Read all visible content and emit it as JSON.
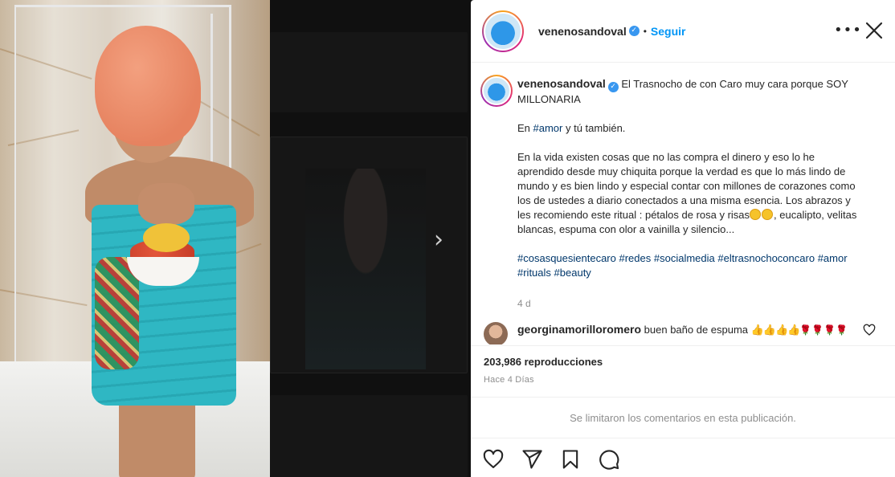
{
  "post": {
    "username": "venenosandoval",
    "verified_mark": "✓",
    "separator": "•",
    "follow_label": "Seguir",
    "more_label": "•••",
    "caption": {
      "line1": "El Trasnocho de con Caro muy cara porque SOY MILLONARIA",
      "para2_prefix": "En ",
      "para2_tag": "#amor",
      "para2_suffix": " y tú también.",
      "para3_main": "En la vida existen cosas que no las compra el dinero y eso lo he aprendido desde muy chiquita porque la verdad es que lo más lindo de mundo y es bien lindo y especial contar con millones de corazones como los de ustedes a diario conectados a una misma esencia. Los abrazos y les recomiendo este ritual : pétalos de rosa y risas",
      "para3_end": ", eucalipto, velitas blancas, espuma con olor a vainilla y silencio...",
      "hashtags": [
        "#cosasquesientecaro",
        "#redes",
        "#socialmedia",
        "#eltrasnochoconcaro",
        "#amor",
        "#rituals",
        "#beauty"
      ]
    },
    "age": "4 d",
    "comment": {
      "username": "georginamorilloromero",
      "text": "buen baño de espuma",
      "thumbs": "👍👍👍👍",
      "roses": "🌹🌹🌹🌹"
    },
    "views": "203,986 reproducciones",
    "since": "Hace 4 Días",
    "comments_limited": "Se limitaron los comentarios en esta publicación."
  },
  "icons": {
    "next": "›",
    "names": [
      "more-icon",
      "close-icon",
      "heart-icon",
      "comment-icon",
      "share-icon",
      "save-icon",
      "next-arrow-icon",
      "verified-icon"
    ]
  },
  "colors": {
    "link": "#0095f6",
    "hashtag": "#00376b",
    "muted": "#8e8e8e",
    "verified": "#3897f0"
  }
}
